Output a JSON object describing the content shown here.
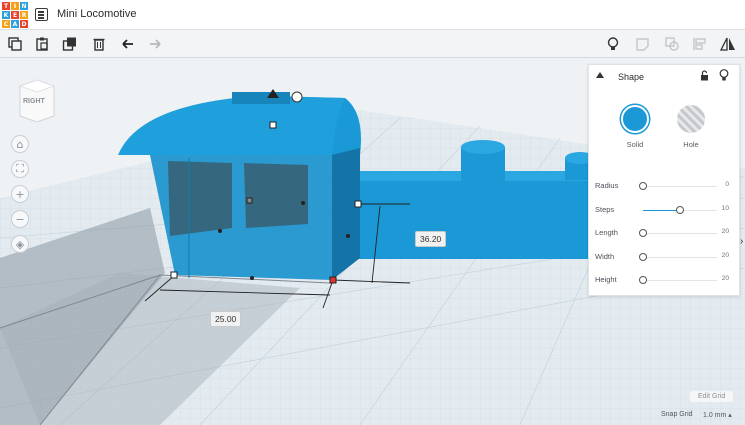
{
  "app": {
    "logo_letters": [
      "T",
      "I",
      "N",
      "K",
      "E",
      "R",
      "C",
      "A",
      "D"
    ],
    "project_title": "Mini Locomotive"
  },
  "toolbar": {
    "left_icons": [
      "copy-icon",
      "paste-icon",
      "duplicate-icon",
      "delete-icon",
      "undo-icon",
      "redo-icon"
    ],
    "right_icons": [
      "lightbulb-icon",
      "note-icon",
      "group-icon",
      "align-icon",
      "mirror-icon"
    ]
  },
  "viewcube": {
    "face_label": "RIGHT"
  },
  "nav_controls": {
    "home": "⌂",
    "fit": "⛶",
    "zoom_in": "+",
    "zoom_out": "−",
    "perspective": "◈"
  },
  "dimensions": {
    "width_label": "25.00",
    "height_label": "36.20"
  },
  "shape_panel": {
    "title": "Shape",
    "options": [
      {
        "label": "Solid",
        "selected": true,
        "color": "#1a99d6"
      },
      {
        "label": "Hole",
        "selected": false
      }
    ],
    "properties": [
      {
        "name": "Radius",
        "value": "0",
        "fraction": 0.0
      },
      {
        "name": "Steps",
        "value": "10",
        "fraction": 0.5
      },
      {
        "name": "Length",
        "value": "20",
        "fraction": 0.0
      },
      {
        "name": "Width",
        "value": "20",
        "fraction": 0.0
      },
      {
        "name": "Height",
        "value": "20",
        "fraction": 0.0
      }
    ]
  },
  "bottom": {
    "edit_grid": "Edit Grid",
    "snap_grid_label": "Snap Grid",
    "snap_grid_value": "1.0 mm ▴"
  },
  "colors": {
    "shape_blue": "#1a99d6",
    "workplane": "#dfe8ee",
    "grid_line": "#c7d3dc"
  }
}
